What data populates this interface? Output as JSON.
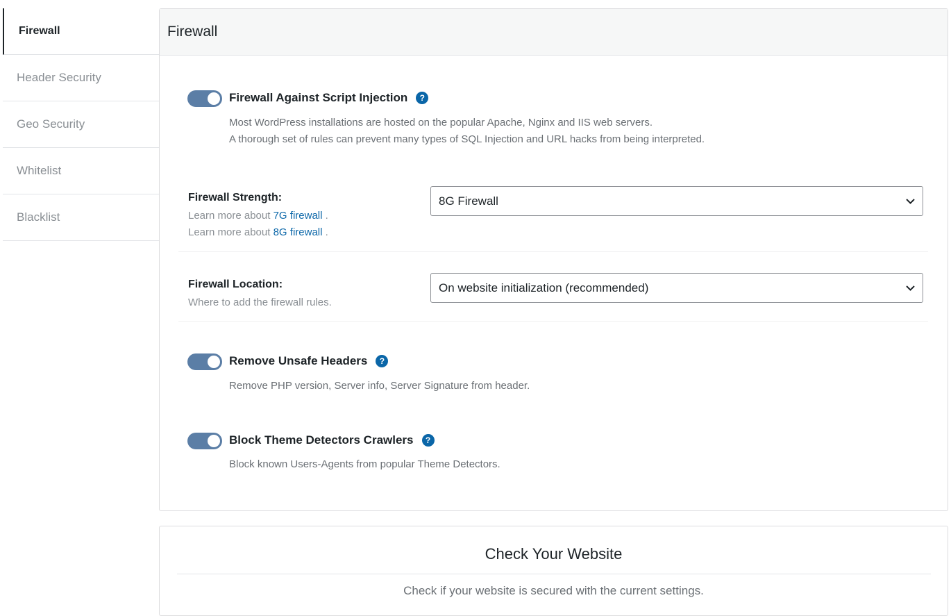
{
  "sidebar": {
    "items": [
      {
        "label": "Firewall"
      },
      {
        "label": "Header Security"
      },
      {
        "label": "Geo Security"
      },
      {
        "label": "Whitelist"
      },
      {
        "label": "Blacklist"
      }
    ]
  },
  "panel": {
    "title": "Firewall",
    "script_injection": {
      "title": "Firewall Against Script Injection",
      "help_icon": "?",
      "desc_line1": "Most WordPress installations are hosted on the popular Apache, Nginx and IIS web servers.",
      "desc_line2": "A thorough set of rules can prevent many types of SQL Injection and URL hacks from being interpreted.",
      "enabled": true
    },
    "strength": {
      "label": "Firewall Strength:",
      "learn_prefix": "Learn more about",
      "link_7g": "7G firewall",
      "link_8g": "8G firewall",
      "suffix": ".",
      "selected": "8G Firewall"
    },
    "location": {
      "label": "Firewall Location:",
      "sub": "Where to add the firewall rules.",
      "selected": "On website initialization (recommended)"
    },
    "unsafe_headers": {
      "title": "Remove Unsafe Headers",
      "help_icon": "?",
      "desc": "Remove PHP version, Server info, Server Signature from header.",
      "enabled": true
    },
    "theme_detectors": {
      "title": "Block Theme Detectors Crawlers",
      "help_icon": "?",
      "desc": "Block known Users-Agents from popular Theme Detectors.",
      "enabled": true
    }
  },
  "check_card": {
    "title": "Check Your Website",
    "desc": "Check if your website is secured with the current settings."
  },
  "colors": {
    "toggle_on": "#5b7ea6",
    "link": "#0a66a8",
    "help_icon_bg": "#0a66a8"
  }
}
